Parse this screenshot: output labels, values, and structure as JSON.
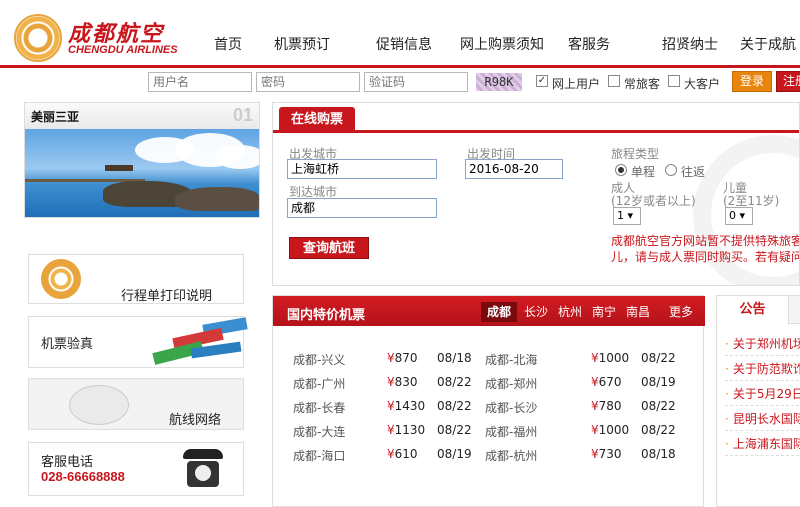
{
  "logo": {
    "cn": "成都航空",
    "en": "CHENGDU AIRLINES"
  },
  "nav": [
    "首页",
    "机票预订",
    "促销信息",
    "网上购票须知",
    "客服务",
    "招贤纳士",
    "关于成航"
  ],
  "login": {
    "username_placeholder": "用户名",
    "password_placeholder": "密码",
    "captcha_placeholder": "验证码",
    "captcha_text": "R98K",
    "user_types": [
      "网上用户",
      "常旅客",
      "大客户"
    ],
    "login_label": "登录",
    "register_label": "注册"
  },
  "promo": {
    "title": "美丽三亚",
    "number": "01"
  },
  "side": {
    "itinerary_label": "行程单打印说明",
    "verify_label": "机票验真",
    "routes_label": "航线网络",
    "phone_title": "客服电话",
    "phone_number": "028-66668888"
  },
  "booking": {
    "tab_label": "在线购票",
    "depart_city_label": "出发城市",
    "depart_city_value": "上海虹桥",
    "arrive_city_label": "到达城市",
    "arrive_city_value": "成都",
    "depart_time_label": "出发时间",
    "depart_time_value": "2016-08-20",
    "trip_type_label": "旅程类型",
    "trip_one_way": "单程",
    "trip_round": "往返",
    "adult_label": "成人",
    "adult_hint": "(12岁或者以上)",
    "adult_value": "1",
    "child_label": "儿童",
    "child_hint": "(2至11岁)",
    "child_value": "0",
    "search_label": "查询航班",
    "notice_line1": "成都航空官方网站暂不提供特殊旅客",
    "notice_line2": "儿，请与成人票同时购买。若有疑问"
  },
  "deals": {
    "title": "国内特价机票",
    "city_tabs": [
      "成都",
      "长沙",
      "杭州",
      "南宁",
      "南昌",
      "更多>>"
    ],
    "currency": "¥",
    "left": [
      {
        "route": "成都-兴义",
        "price": "870",
        "date": "08/18"
      },
      {
        "route": "成都-广州",
        "price": "830",
        "date": "08/22"
      },
      {
        "route": "成都-长春",
        "price": "1430",
        "date": "08/22"
      },
      {
        "route": "成都-大连",
        "price": "1130",
        "date": "08/22"
      },
      {
        "route": "成都-海口",
        "price": "610",
        "date": "08/19"
      }
    ],
    "right": [
      {
        "route": "成都-北海",
        "price": "1000",
        "date": "08/22"
      },
      {
        "route": "成都-郑州",
        "price": "670",
        "date": "08/19"
      },
      {
        "route": "成都-长沙",
        "price": "780",
        "date": "08/22"
      },
      {
        "route": "成都-福州",
        "price": "1000",
        "date": "08/22"
      },
      {
        "route": "成都-杭州",
        "price": "730",
        "date": "08/18"
      }
    ]
  },
  "announcements": {
    "tab_label": "公告",
    "items": [
      "关于郑州机场",
      "关于防范欺诈",
      "关于5月29日",
      "昆明长水国际",
      "上海浦东国际"
    ]
  },
  "colors": {
    "brand_red": "#c8161d",
    "accent_orange": "#e8850e"
  }
}
